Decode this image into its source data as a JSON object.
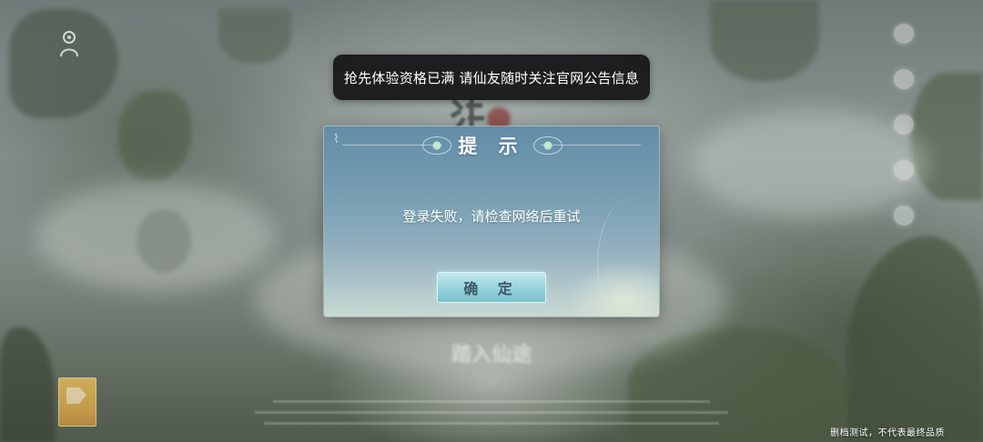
{
  "toast": {
    "text": "抢先体验资格已满 请仙友随时关注官网公告信息"
  },
  "dialog": {
    "title": "提 示",
    "message": "登录失败，请检查网络后重试",
    "confirm_label": "确 定",
    "accent_color": "#8fd3dd"
  },
  "background": {
    "title": "踏入仙途"
  },
  "footer": {
    "disclaimer": "删档测试，不代表最终品质"
  },
  "icons": {
    "left_top": "character-icon",
    "right_menu": [
      "menu-icon-1",
      "menu-icon-2",
      "menu-icon-3",
      "menu-icon-4",
      "menu-icon-5"
    ],
    "age_rating": "age-rating-icon"
  }
}
